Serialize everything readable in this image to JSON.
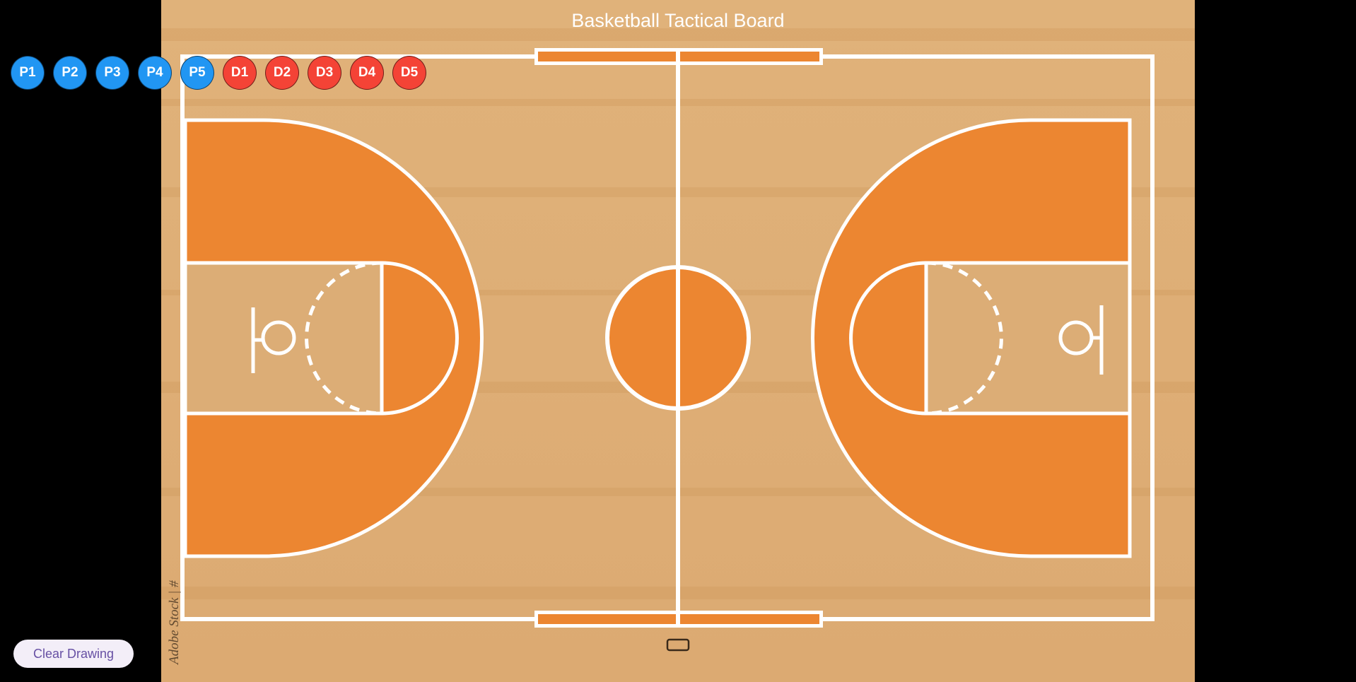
{
  "title": "Basketball Tactical Board",
  "tokens": {
    "offense": [
      "P1",
      "P2",
      "P3",
      "P4",
      "P5"
    ],
    "defense": [
      "D1",
      "D2",
      "D3",
      "D4",
      "D5"
    ]
  },
  "clear_button": {
    "label": "Clear Drawing"
  },
  "watermark": "Adobe Stock | #"
}
